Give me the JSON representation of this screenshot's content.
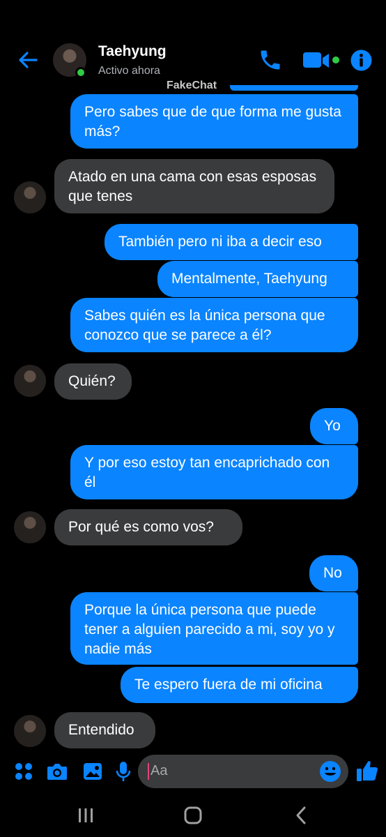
{
  "header": {
    "contact_name": "Taehyung",
    "status": "Activo ahora",
    "watermark": "FakeChat",
    "icons": [
      "back-arrow-icon",
      "phone-icon",
      "video-camera-icon",
      "info-icon"
    ]
  },
  "messages": [
    {
      "side": "out",
      "text": "Pero sabes que de que forma me gusta más?"
    },
    {
      "side": "in",
      "text": "Atado en una cama con esas esposas que tenes"
    },
    {
      "side": "out",
      "text": "También pero ni iba a decir eso"
    },
    {
      "side": "out",
      "text": "Mentalmente, Taehyung"
    },
    {
      "side": "out",
      "text": "Sabes quién es la única persona que conozco que se parece a él?"
    },
    {
      "side": "in",
      "text": "Quién?"
    },
    {
      "side": "out",
      "text": "Yo"
    },
    {
      "side": "out",
      "text": "Y por eso estoy tan encaprichado con él"
    },
    {
      "side": "in",
      "text": "Por qué es como vos?"
    },
    {
      "side": "out",
      "text": "No"
    },
    {
      "side": "out",
      "text": "Porque la única persona que puede tener a alguien parecido a mi, soy yo y nadie más"
    },
    {
      "side": "out",
      "text": "Te espero fuera de mi oficina"
    },
    {
      "side": "in",
      "text": "Entendido"
    }
  ],
  "composer": {
    "placeholder": "Aa",
    "icons": [
      "apps-icon",
      "camera-icon",
      "gallery-icon",
      "microphone-icon",
      "emoji-icon",
      "thumbs-up-icon"
    ]
  },
  "colors": {
    "accent": "#0a84ff",
    "incoming_bubble": "#3a3b3c",
    "background": "#000000",
    "online": "#31cc46"
  }
}
